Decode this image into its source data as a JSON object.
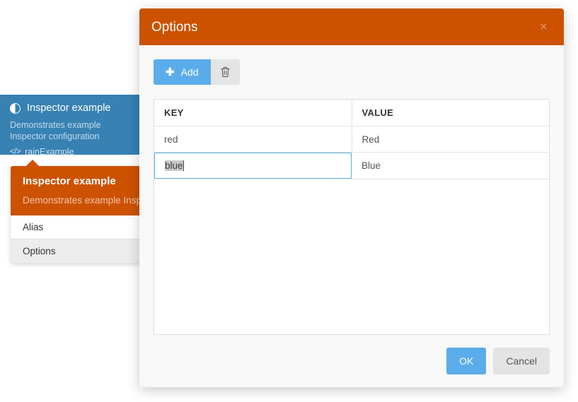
{
  "background": {
    "card": {
      "icon": "contrast-icon",
      "title": "Inspector example",
      "description": "Demonstrates example Inspector configuration",
      "code_icon": "</>",
      "code_label": "rainExample",
      "bg_color": "#3781b3"
    },
    "popover": {
      "title": "Inspector example",
      "description": "Demonstrates example Insp",
      "header_color": "#cc5200",
      "items": [
        {
          "label": "Alias",
          "active": false
        },
        {
          "label": "Options",
          "active": true
        }
      ]
    }
  },
  "dialog": {
    "title": "Options",
    "close_label": "×",
    "header_color": "#cc5200",
    "toolbar": {
      "add_label": "Add",
      "add_icon": "plus-icon",
      "add_color": "#5bacea",
      "delete_icon": "trash-icon"
    },
    "table": {
      "columns": [
        "KEY",
        "VALUE"
      ],
      "rows": [
        {
          "key": "red",
          "value": "Red",
          "editing": false
        },
        {
          "key": "blue",
          "value": "Blue",
          "editing": true
        }
      ],
      "editing_cell": {
        "text": "blue",
        "selected": true,
        "focus_border_color": "#59a9e0",
        "selection_color": "#c9c9c9"
      }
    },
    "footer": {
      "ok_label": "OK",
      "cancel_label": "Cancel",
      "ok_color": "#5bacea",
      "cancel_color": "#e4e4e4"
    }
  }
}
